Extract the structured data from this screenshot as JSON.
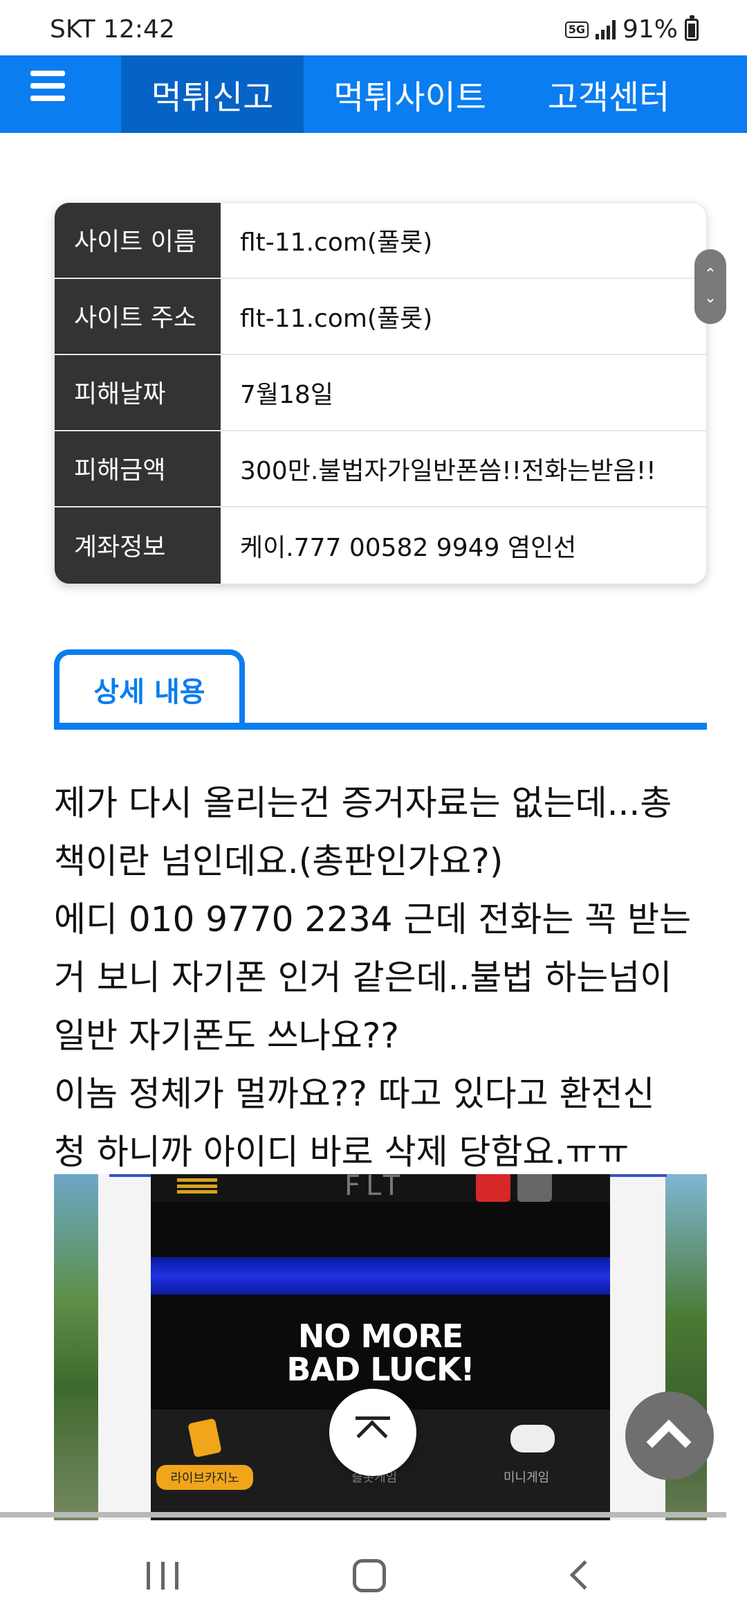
{
  "status_bar": {
    "carrier_time": "SKT 12:42",
    "network": "5G",
    "battery": "91%"
  },
  "nav": {
    "tabs": [
      {
        "label": "먹튀신고"
      },
      {
        "label": "먹튀사이트"
      },
      {
        "label": "고객센터"
      }
    ]
  },
  "report": {
    "rows": [
      {
        "key": "사이트 이름",
        "value": "flt-11.com(풀롯)"
      },
      {
        "key": "사이트 주소",
        "value": "flt-11.com(풀롯)"
      },
      {
        "key": "피해날짜",
        "value": "7월18일"
      },
      {
        "key": "피해금액",
        "value": "300만.불법자가일반폰씀!!전화는받음!!"
      },
      {
        "key": "계좌정보",
        "value": "케이.777 00582 9949 염인선"
      }
    ]
  },
  "detail": {
    "tab_label": "상세 내용",
    "lines": [
      "제가 다시 올리는건 증거자료는 없는데...총",
      "책이란 넘인데요.(총판인가요?)",
      "에디 010 9770 2234 근데 전화는 꼭 받는",
      "거 보니 자기폰 인거 같은데..불법 하는넘이",
      "일반 자기폰도 쓰나요??",
      "이놈 정체가 멀까요?? 따고 있다고 환전신",
      "청 하니까 아이디 바로 삭제 당함요.ㅠㅠ"
    ]
  },
  "embedded_screenshot": {
    "logo": "FLT",
    "headline_1": "NO MORE",
    "headline_2": "BAD LUCK!",
    "btn_live": "라이브카지노",
    "label_slot": "슬롯게임",
    "label_mini": "미니게임"
  }
}
